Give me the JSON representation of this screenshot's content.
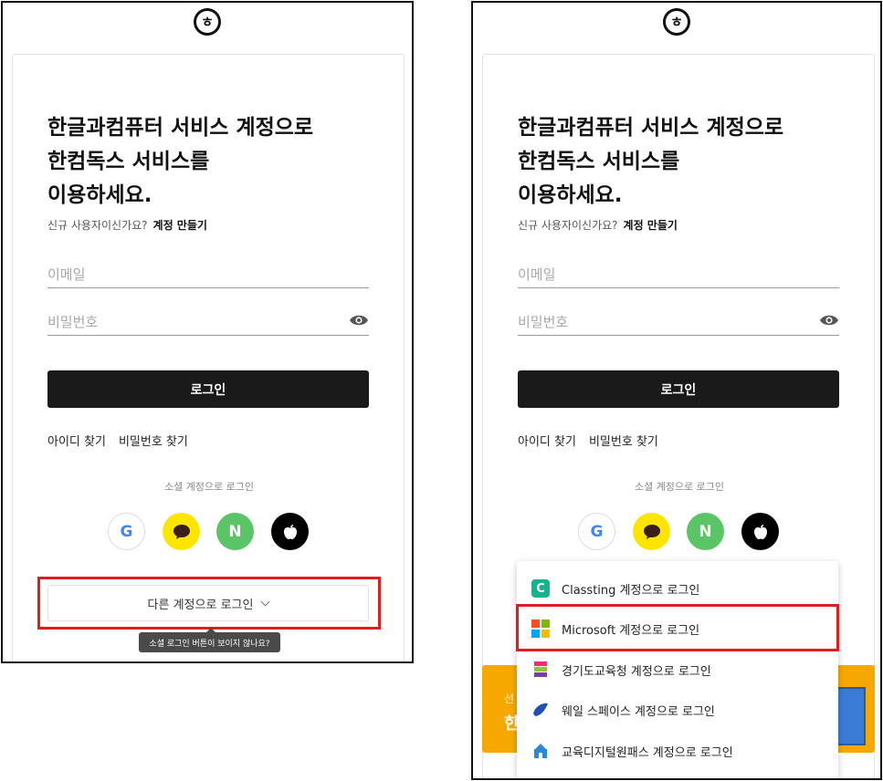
{
  "logo": {
    "glyph": "ㅎ",
    "icon": "hancom-logo-icon"
  },
  "headline": [
    "한글과컴퓨터 서비스 계정으로",
    "한컴독스 서비스를",
    "이용하세요."
  ],
  "signup": {
    "question": "신규 사용자이신가요?",
    "link": "계정 만들기"
  },
  "form": {
    "email_placeholder": "이메일",
    "password_placeholder": "비밀번호",
    "login_button": "로그인"
  },
  "links": {
    "find_id": "아이디 찾기",
    "find_password": "비밀번호 찾기"
  },
  "social": {
    "label": "소셜 계정으로 로그인",
    "providers": [
      {
        "name": "google",
        "glyph": "G"
      },
      {
        "name": "kakao",
        "glyph": ""
      },
      {
        "name": "naver",
        "glyph": "N"
      },
      {
        "name": "apple",
        "glyph": ""
      }
    ]
  },
  "other_login": {
    "label": "다른 계정으로 로그인"
  },
  "tooltip": "소셜 로그인 버튼이 보이지 않나요?",
  "dropdown": {
    "items": [
      {
        "label": "Classting 계정으로 로그인",
        "icon": "classting-icon"
      },
      {
        "label": "Microsoft 계정으로 로그인",
        "icon": "microsoft-icon"
      },
      {
        "label": "경기도교육청 계정으로 로그인",
        "icon": "gyeonggi-edu-icon"
      },
      {
        "label": "웨일 스페이스 계정으로 로그인",
        "icon": "whale-icon"
      },
      {
        "label": "교육디지털원패스 계정으로 로그인",
        "icon": "edu-onepass-icon"
      }
    ]
  },
  "banner": {
    "line1": "선",
    "line2": "한"
  },
  "colors": {
    "login_button": "#1a1a1a",
    "highlight": "#e01e1e",
    "kakao": "#fee500",
    "naver": "#5ac466",
    "banner": "#f7a800"
  }
}
